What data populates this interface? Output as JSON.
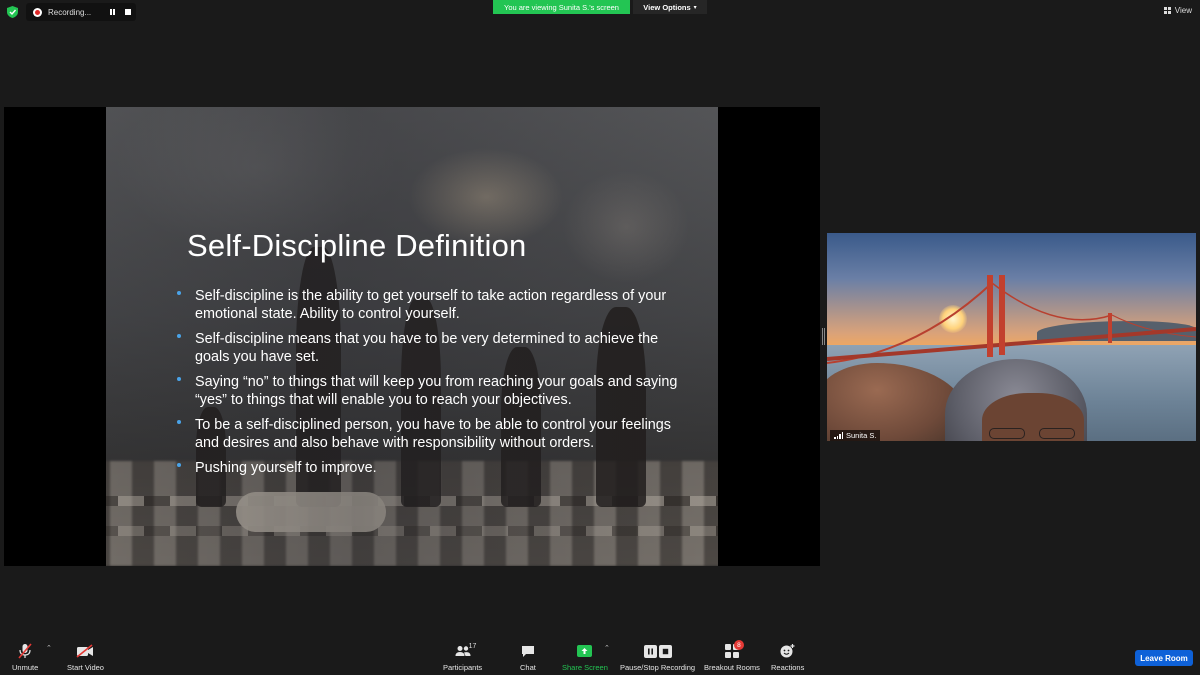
{
  "top_bar": {
    "recording_label": "Recording...",
    "viewing_banner": "You are viewing Sunita S.'s screen",
    "view_options_label": "View Options",
    "view_label": "View"
  },
  "slide": {
    "title": "Self-Discipline Definition",
    "bullets": [
      "Self-discipline is the ability to get yourself to take action regardless of your emotional state. Ability to control yourself.",
      "Self-discipline means that you have to be very determined to achieve the goals you have set.",
      "Saying “no” to things that will keep you from reaching your goals and saying “yes” to things that will enable you to reach your objectives.",
      "To be a self-disciplined person, you have to be able to control your feelings and desires and also behave with responsibility without orders.",
      "Pushing yourself to improve."
    ]
  },
  "video": {
    "participant_name": "Sunita S."
  },
  "toolbar": {
    "unmute_label": "Unmute",
    "start_video_label": "Start Video",
    "participants_label": "Participants",
    "participants_count": "17",
    "chat_label": "Chat",
    "share_screen_label": "Share Screen",
    "pause_stop_recording_label": "Pause/Stop Recording",
    "breakout_rooms_label": "Breakout Rooms",
    "breakout_rooms_badge": "8",
    "reactions_label": "Reactions",
    "leave_room_label": "Leave Room"
  },
  "colors": {
    "share_green": "#23c553",
    "leave_blue": "#0e61d8",
    "badge_red": "#e53935",
    "bullet_blue": "#4aa3e8"
  },
  "icons": [
    "shield-icon",
    "record-icon",
    "pause-icon",
    "stop-icon",
    "chevron-down-icon",
    "grid-view-icon",
    "microphone-muted-icon",
    "video-off-icon",
    "participants-icon",
    "chat-icon",
    "share-screen-icon",
    "pause-stop-icon",
    "breakout-rooms-icon",
    "reactions-icon",
    "signal-icon"
  ]
}
